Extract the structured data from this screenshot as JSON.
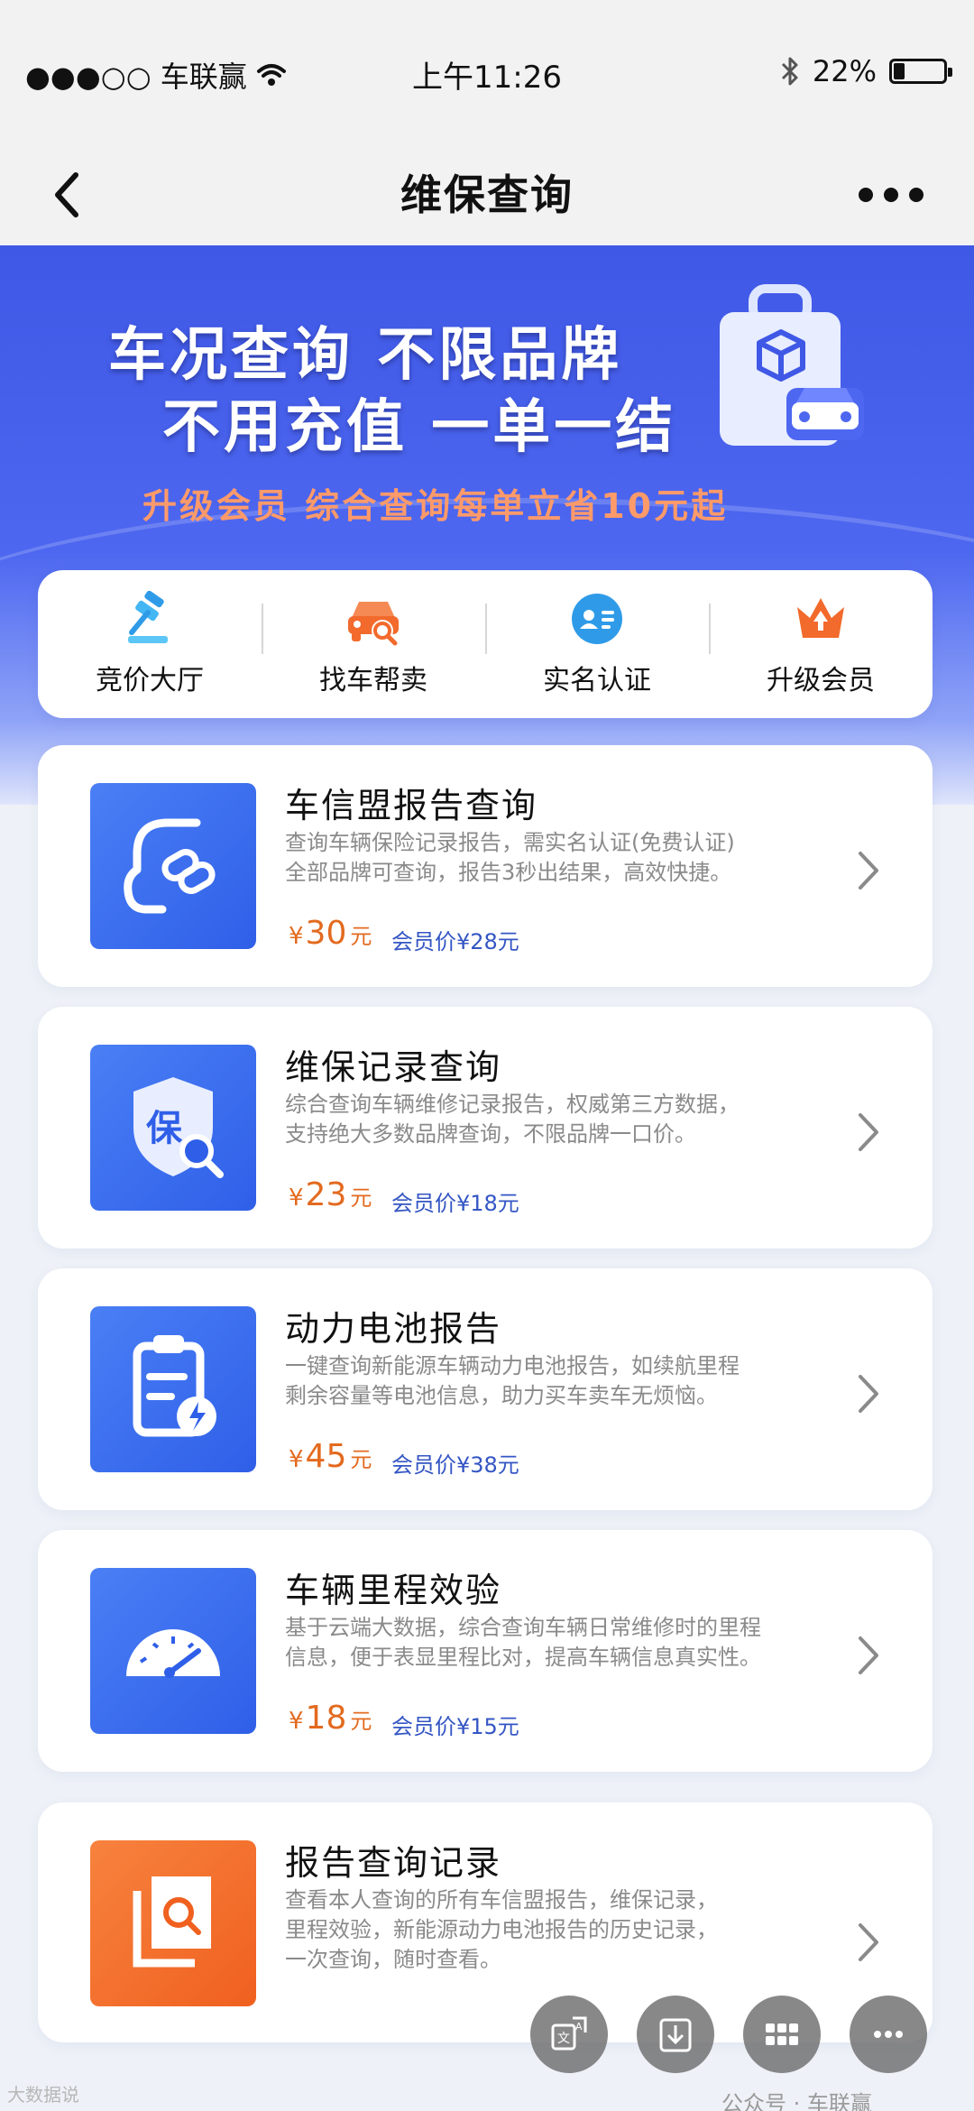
{
  "status_bar": {
    "carrier": "●●●○○ 车联赢",
    "time": "上午11:26",
    "battery_text": "22%",
    "battery_level": 0.22
  },
  "nav": {
    "title": "维保查询"
  },
  "banner": {
    "line1": "车况查询 不限品牌",
    "line2": "不用充值 一单一结",
    "subtitle": "升级会员  综合查询每单立省10元起"
  },
  "quick_menu": [
    {
      "label": "竞价大厅",
      "icon": "gavel-icon"
    },
    {
      "label": "找车帮卖",
      "icon": "car-search-icon"
    },
    {
      "label": "实名认证",
      "icon": "id-card-icon"
    },
    {
      "label": "升级会员",
      "icon": "crown-icon"
    }
  ],
  "cards": [
    {
      "title": "车信盟报告查询",
      "desc": "查询车辆保险记录报告，需实名认证(免费认证)\n全部品牌可查询，报告3秒出结果，高效快捷。",
      "price": "30",
      "member_price": "会员价¥28元",
      "icon": "car-link-icon",
      "color": "#3f72f0"
    },
    {
      "title": "维保记录查询",
      "desc": "综合查询车辆维修记录报告，权威第三方数据，\n支持绝大多数品牌查询，不限品牌一口价。",
      "price": "23",
      "member_price": "会员价¥18元",
      "icon": "shield-search-icon",
      "color": "#3f72f0"
    },
    {
      "title": "动力电池报告",
      "desc": "一键查询新能源车辆动力电池报告，如续航里程\n剩余容量等电池信息，助力买车卖车无烦恼。",
      "price": "45",
      "member_price": "会员价¥38元",
      "icon": "battery-report-icon",
      "color": "#3f72f0"
    },
    {
      "title": "车辆里程效验",
      "desc": "基于云端大数据，综合查询车辆日常维修时的里程\n信息，便于表显里程比对，提高车辆信息真实性。",
      "price": "18",
      "member_price": "会员价¥15元",
      "icon": "speedometer-icon",
      "color": "#3f72f0"
    },
    {
      "title": "报告查询记录",
      "desc": "查看本人查询的所有车信盟报告，维保记录，\n里程效验，新能源动力电池报告的历史记录，\n一次查询，随时查看。",
      "price": "",
      "member_price": "",
      "icon": "document-search-icon",
      "color": "#f26a2c"
    }
  ],
  "currency": {
    "yen": "¥",
    "unit": "元"
  },
  "watermark": "公众号 · 车联赢",
  "watermark_left": "大数据说"
}
